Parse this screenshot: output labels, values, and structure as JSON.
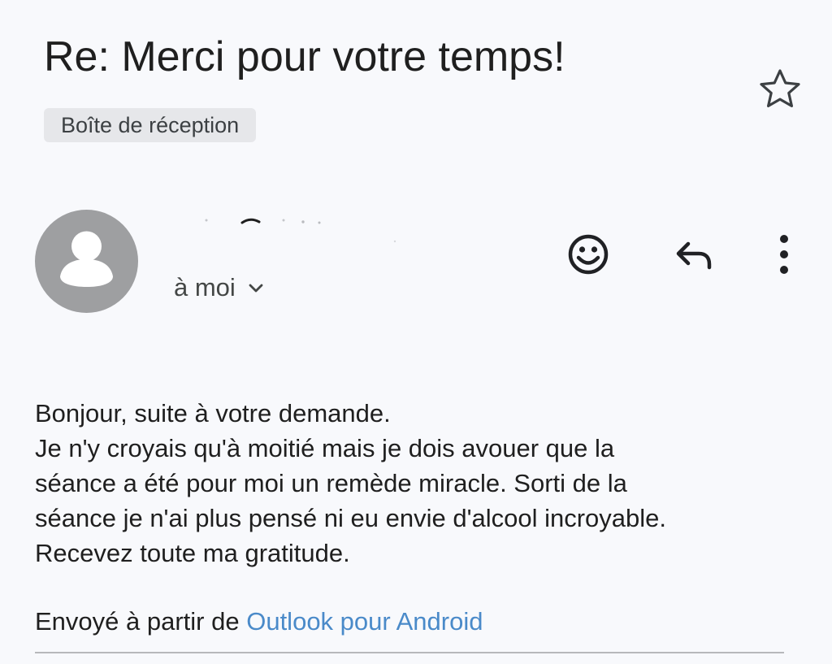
{
  "email": {
    "subject": "Re: Merci pour votre temps!",
    "label": "Boîte de réception",
    "recipient_label": "à moi",
    "body_lines": [
      "Bonjour, suite à votre demande.",
      "Je n'y croyais qu'à moitié mais je dois avouer que la",
      "séance a été pour moi un remède miracle. Sorti de la",
      "séance je n'ai plus pensé ni eu envie d'alcool incroyable.",
      "Recevez toute ma gratitude."
    ],
    "signature_prefix": "Envoyé à partir de",
    "signature_link": "Outlook pour Android"
  },
  "icons": {
    "star": "star-outline-icon",
    "avatar": "person-icon",
    "recipient_toggle": "chevron-down-icon",
    "emoji": "emoji-icon",
    "reply": "reply-icon",
    "more": "more-vert-icon"
  },
  "colors": {
    "background": "#f8f9fc",
    "text": "#1f1f1f",
    "secondary_text": "#444746",
    "chip_background": "#e6e7ea",
    "avatar": "#9e9fa1",
    "link": "#4a8ac9"
  }
}
